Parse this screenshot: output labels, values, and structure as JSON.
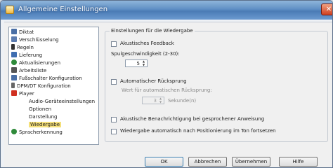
{
  "window": {
    "title": "Allgemeine Einstellungen",
    "close_glyph": "✕"
  },
  "tree": {
    "items": [
      {
        "label": "Diktat",
        "icon": "dictation-icon",
        "color": "#4a6fa5"
      },
      {
        "label": "Verschlüsselung",
        "icon": "encryption-icon",
        "color": "#5c7cb0"
      },
      {
        "label": "Regeln",
        "icon": "rules-icon",
        "color": "#333333"
      },
      {
        "label": "Lieferung",
        "icon": "delivery-icon",
        "color": "#3f6db0"
      },
      {
        "label": "Aktualisierungen",
        "icon": "updates-icon",
        "color": "#2f8a3a"
      },
      {
        "label": "Arbeitsliste",
        "icon": "worklist-icon",
        "color": "#555555"
      },
      {
        "label": "Fußschalter Konfiguration",
        "icon": "footswitch-icon",
        "color": "#4a6fa5"
      },
      {
        "label": "DPM/DT Konfiguration",
        "icon": "dpm-icon",
        "color": "#666666"
      },
      {
        "label": "Player",
        "icon": "player-icon",
        "color": "#d03020"
      },
      {
        "label": "Audio-Geräteeinstellungen",
        "icon": "",
        "color": ""
      },
      {
        "label": "Optionen",
        "icon": "",
        "color": ""
      },
      {
        "label": "Darstellung",
        "icon": "",
        "color": ""
      },
      {
        "label": "Wiedergabe",
        "icon": "",
        "color": "",
        "selected": true
      },
      {
        "label": "Spracherkennung",
        "icon": "speech-recognition-icon",
        "color": "#2f8a3a"
      }
    ]
  },
  "group": {
    "title": "Einstellungen für die Wiedergabe",
    "acoustic_feedback": "Akustisches Feedback",
    "spool_speed_label": "Spulgeschwindigkeit (2-30):",
    "spool_speed_value": "5",
    "auto_rewind": "Automatischer Rücksprung",
    "auto_rewind_value_label": "Wert für automatischen Rücksprung:",
    "auto_rewind_value": "3",
    "seconds_label": "Sekunde(n)",
    "acoustic_notify": "Akustische Benachrichtigung bei gesprochener Anweisung",
    "auto_continue": "Wiedergabe automatisch nach Positionierung im Ton fortsetzen"
  },
  "buttons": {
    "ok": "OK",
    "cancel": "Abbrechen",
    "apply": "Übernehmen",
    "help": "Hilfe"
  }
}
